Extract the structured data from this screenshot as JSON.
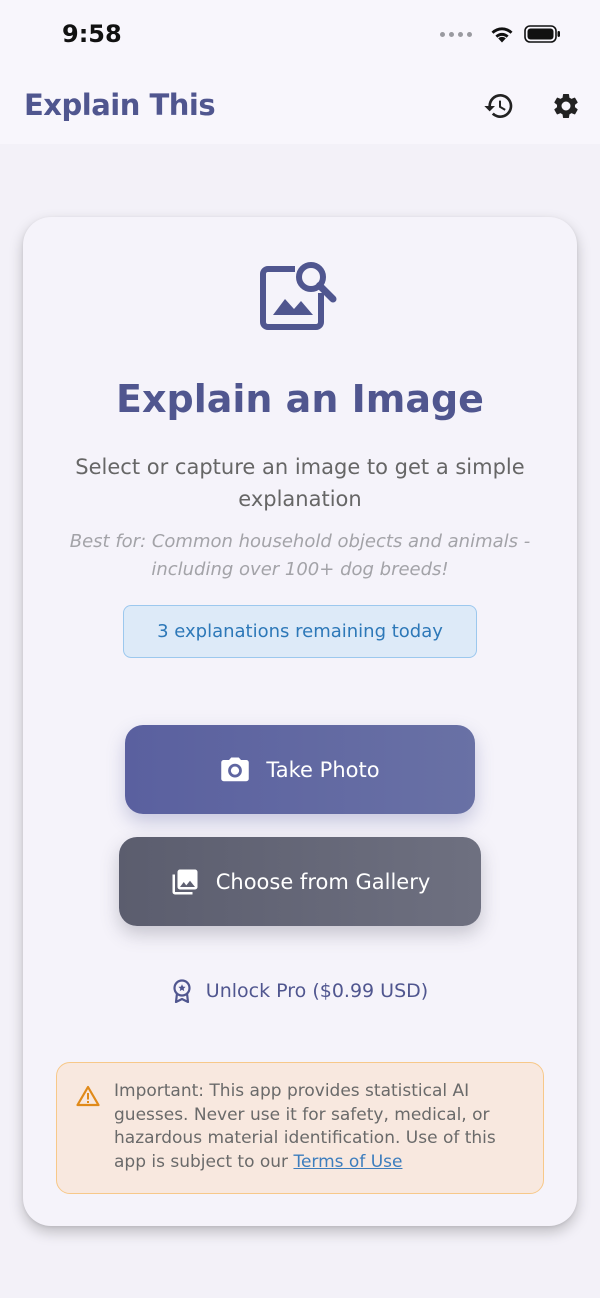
{
  "status": {
    "time": "9:58"
  },
  "app_bar": {
    "title": "Explain This",
    "history_icon": "history-icon",
    "settings_icon": "gear-icon"
  },
  "card": {
    "hero_icon": "image-search-icon",
    "title": "Explain an Image",
    "subtitle": "Select or capture an image to get a simple explanation",
    "best_for": "Best for: Common household objects and animals - including over 100+ dog breeds!",
    "remaining": "3 explanations remaining today",
    "take_photo_label": "Take Photo",
    "take_photo_icon": "camera-icon",
    "gallery_label": "Choose from Gallery",
    "gallery_icon": "photo-library-icon",
    "unlock_label": "Unlock Pro ($0.99 USD)",
    "unlock_icon": "badge-icon",
    "warning": {
      "icon": "warning-icon",
      "text": "Important: This app provides statistical AI guesses. Never use it for safety, medical, or hazardous material identification. Use of this app is subject to our ",
      "link": "Terms of Use"
    }
  },
  "colors": {
    "primary": "#50568f",
    "background": "#f3f1f8",
    "card": "#f5f3fa",
    "info_bg": "#ddeaf8",
    "info_text": "#2d78b8",
    "warning_bg": "#f8e8df",
    "warning_border": "#f7c889",
    "warning_icon": "#e08a1a"
  }
}
